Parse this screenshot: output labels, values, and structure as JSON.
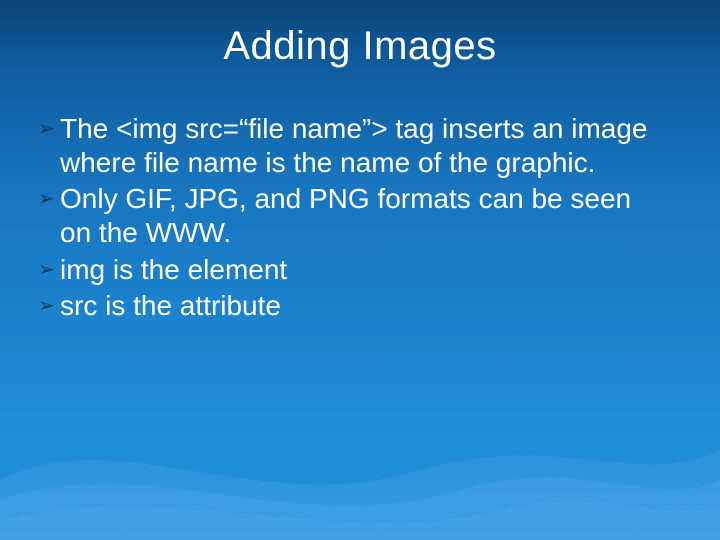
{
  "slide": {
    "title": "Adding Images",
    "bullets": [
      "The <img src=“file name”> tag inserts an image where file name is the name of the graphic.",
      "Only GIF, JPG, and PNG formats can be seen on the WWW.",
      "img is the element",
      "src is the attribute"
    ],
    "bullet_glyph": "➢"
  }
}
